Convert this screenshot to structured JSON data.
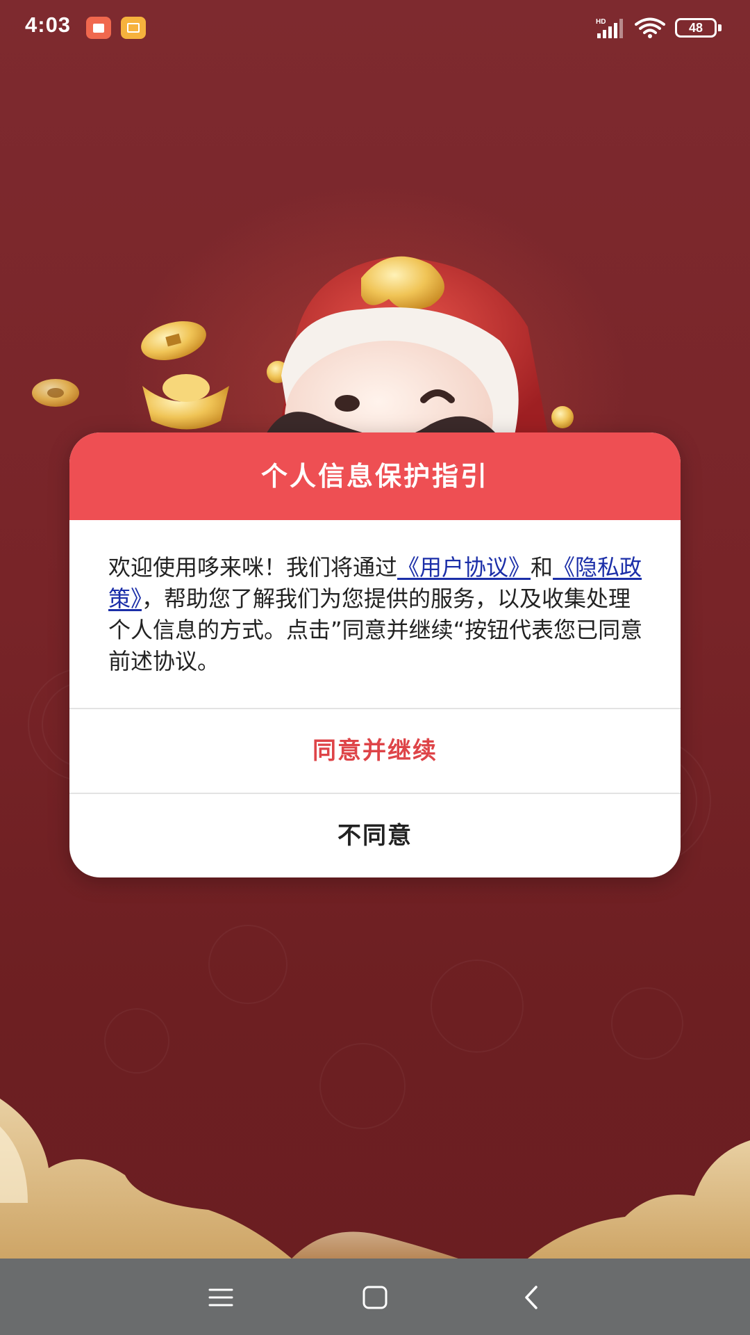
{
  "status_bar": {
    "time": "4:03",
    "network": "HD",
    "battery": "48",
    "notification_icons": [
      "calendar-app-icon",
      "gallery-app-icon"
    ]
  },
  "dialog": {
    "title": "个人信息保护指引",
    "body": {
      "text_1": "欢迎使用哆来咪！我们将通过",
      "link_user_agreement": "《用户协议》",
      "text_2": "和",
      "link_privacy_policy": "《隐私政策》",
      "text_3": "，帮助您了解我们为您提供的服务，以及收集处理个人信息的方式。点击”同意并继续“按钮代表您已同意前述协议。"
    },
    "agree_label": "同意并继续",
    "disagree_label": "不同意"
  },
  "nav_bar": {
    "icons": [
      "menu-icon",
      "home-icon",
      "back-icon"
    ]
  },
  "colors": {
    "background": "#7a2629",
    "dialog_header": "#ee4f53",
    "agree_text": "#de4448",
    "link": "#1b2ea8",
    "nav_bar": "#6a6c6d"
  }
}
